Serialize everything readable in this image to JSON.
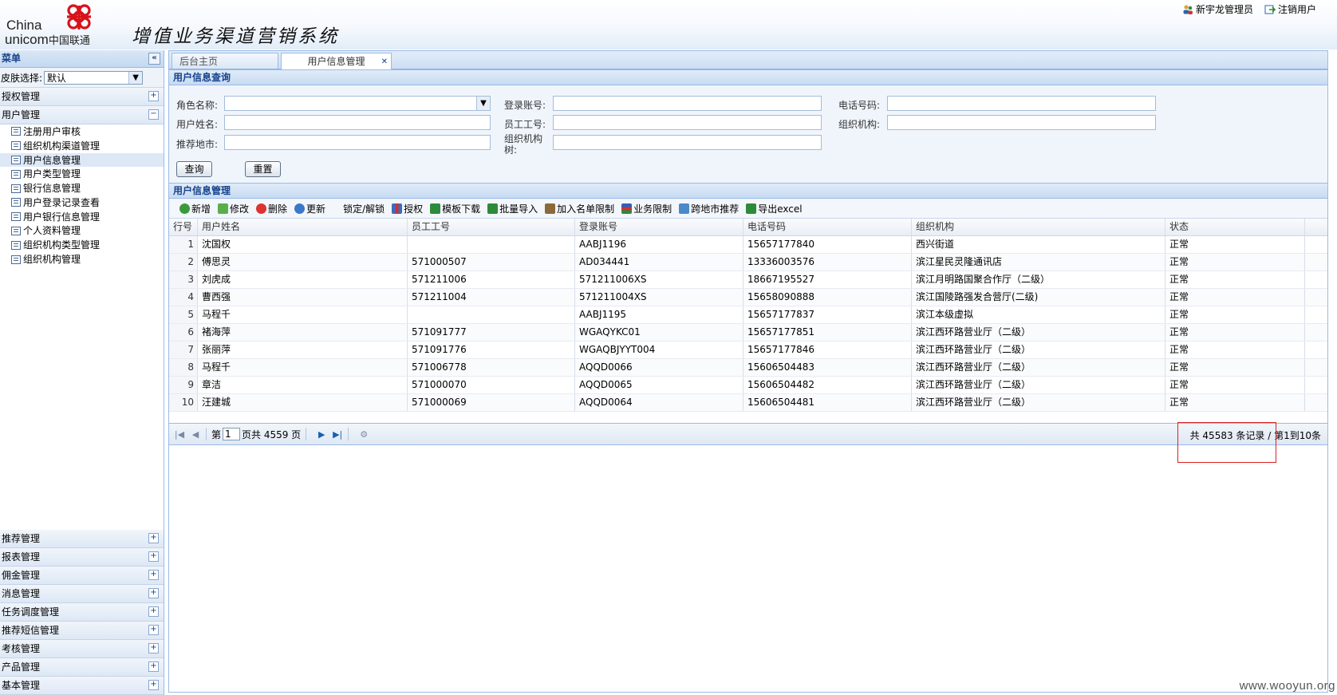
{
  "header": {
    "logo_china": "China",
    "logo_unicom": "unicom",
    "logo_cn": "中国联通",
    "system_title": "增值业务渠道营销系统",
    "admin_link": "新宇龙管理员",
    "logout_link": "注销用户"
  },
  "sidebar": {
    "title": "菜单",
    "skin_label": "皮肤选择:",
    "skin_value": "默认",
    "group_auth": "授权管理",
    "group_user": "用户管理",
    "sub_items": [
      {
        "label": "注册用户审核"
      },
      {
        "label": "组织机构渠道管理"
      },
      {
        "label": "用户信息管理"
      },
      {
        "label": "用户类型管理"
      },
      {
        "label": "银行信息管理"
      },
      {
        "label": "用户登录记录查看"
      },
      {
        "label": "用户银行信息管理"
      },
      {
        "label": "个人资料管理"
      },
      {
        "label": "组织机构类型管理"
      },
      {
        "label": "组织机构管理"
      }
    ],
    "bottom_groups": [
      {
        "label": "推荐管理"
      },
      {
        "label": "报表管理"
      },
      {
        "label": "佣金管理"
      },
      {
        "label": "消息管理"
      },
      {
        "label": "任务调度管理"
      },
      {
        "label": "推荐短信管理"
      },
      {
        "label": "考核管理"
      },
      {
        "label": "产品管理"
      },
      {
        "label": "基本管理"
      }
    ]
  },
  "tabs": {
    "home": "后台主页",
    "active": "用户信息管理"
  },
  "query": {
    "title": "用户信息查询",
    "role_label": "角色名称:",
    "login_label": "登录账号:",
    "phone_label": "电话号码:",
    "name_label": "用户姓名:",
    "emp_label": "员工工号:",
    "org_label": "组织机构:",
    "city_label": "推荐地市:",
    "orgtree_label": "组织机构树:",
    "search_btn": "查询",
    "reset_btn": "重置"
  },
  "grid": {
    "title": "用户信息管理",
    "toolbar": {
      "add": "新增",
      "edit": "修改",
      "delete": "删除",
      "refresh": "更新",
      "lock": "锁定/解锁",
      "grant": "授权",
      "template": "模板下载",
      "import": "批量导入",
      "whitelist": "加入名单限制",
      "biz_limit": "业务限制",
      "cross_city": "跨地市推荐",
      "export": "导出excel"
    },
    "columns": {
      "rownum": "行号",
      "name": "用户姓名",
      "emp": "员工工号",
      "login": "登录账号",
      "phone": "电话号码",
      "org": "组织机构",
      "status": "状态"
    },
    "rows": [
      {
        "n": "1",
        "name": "沈国权",
        "emp": "",
        "login": "AABJ1196",
        "phone": "15657177840",
        "org": "西兴街道",
        "status": "正常"
      },
      {
        "n": "2",
        "name": "傅思灵",
        "emp": "571000507",
        "login": "AD034441",
        "phone": "13336003576",
        "org": "滨江星民灵隆通讯店",
        "status": "正常"
      },
      {
        "n": "3",
        "name": "刘虎成",
        "emp": "571211006",
        "login": "571211006XS",
        "phone": "18667195527",
        "org": "滨江月明路国聚合作厅（二级）",
        "status": "正常"
      },
      {
        "n": "4",
        "name": "曹西强",
        "emp": "571211004",
        "login": "571211004XS",
        "phone": "15658090888",
        "org": "滨江国陵路强发合营厅(二级)",
        "status": "正常"
      },
      {
        "n": "5",
        "name": "马程千",
        "emp": "",
        "login": "AABJ1195",
        "phone": "15657177837",
        "org": "滨江本级虚拟",
        "status": "正常"
      },
      {
        "n": "6",
        "name": "褚海萍",
        "emp": "571091777",
        "login": "WGAQYKC01",
        "phone": "15657177851",
        "org": "滨江西环路营业厅（二级）",
        "status": "正常"
      },
      {
        "n": "7",
        "name": "张丽萍",
        "emp": "571091776",
        "login": "WGAQBJYYT004",
        "phone": "15657177846",
        "org": "滨江西环路营业厅（二级）",
        "status": "正常"
      },
      {
        "n": "8",
        "name": "马程千",
        "emp": "571006778",
        "login": "AQQD0066",
        "phone": "15606504483",
        "org": "滨江西环路营业厅（二级）",
        "status": "正常"
      },
      {
        "n": "9",
        "name": "章洁",
        "emp": "571000070",
        "login": "AQQD0065",
        "phone": "15606504482",
        "org": "滨江西环路营业厅（二级）",
        "status": "正常"
      },
      {
        "n": "10",
        "name": "汪建城",
        "emp": "571000069",
        "login": "AQQD0064",
        "phone": "15606504481",
        "org": "滨江西环路营业厅（二级）",
        "status": "正常"
      }
    ],
    "pager": {
      "page_prefix": "第",
      "page_value": "1",
      "page_suffix": "页共 4559 页",
      "info": "共 45583 条记录 / 第1到10条"
    }
  },
  "watermark": "www.wooyun.org"
}
